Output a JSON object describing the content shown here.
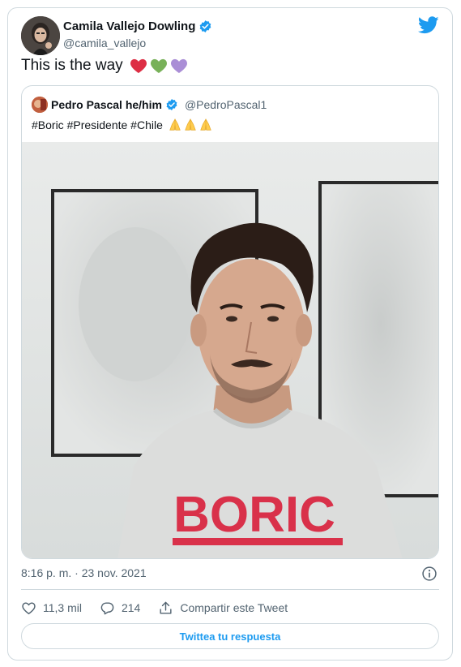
{
  "tweet": {
    "author_name": "Camila Vallejo Dowling",
    "author_handle": "@camila_vallejo",
    "text": "This is the way",
    "timestamp": "8:16 p. m. · 23 nov. 2021"
  },
  "quoted": {
    "author_name": "Pedro Pascal he/him",
    "author_handle": "@PedroPascal1",
    "text": "#Boric #Presidente #Chile",
    "photo_shirt_text": "BORIC"
  },
  "actions": {
    "likes": "11,3 mil",
    "replies": "214",
    "share_label": "Compartir este Tweet"
  },
  "reply_button": "Twittea tu respuesta",
  "colors": {
    "accent": "#1d9bf0",
    "verified": "#1d9bf0",
    "shirt_print": "#d9314a"
  }
}
